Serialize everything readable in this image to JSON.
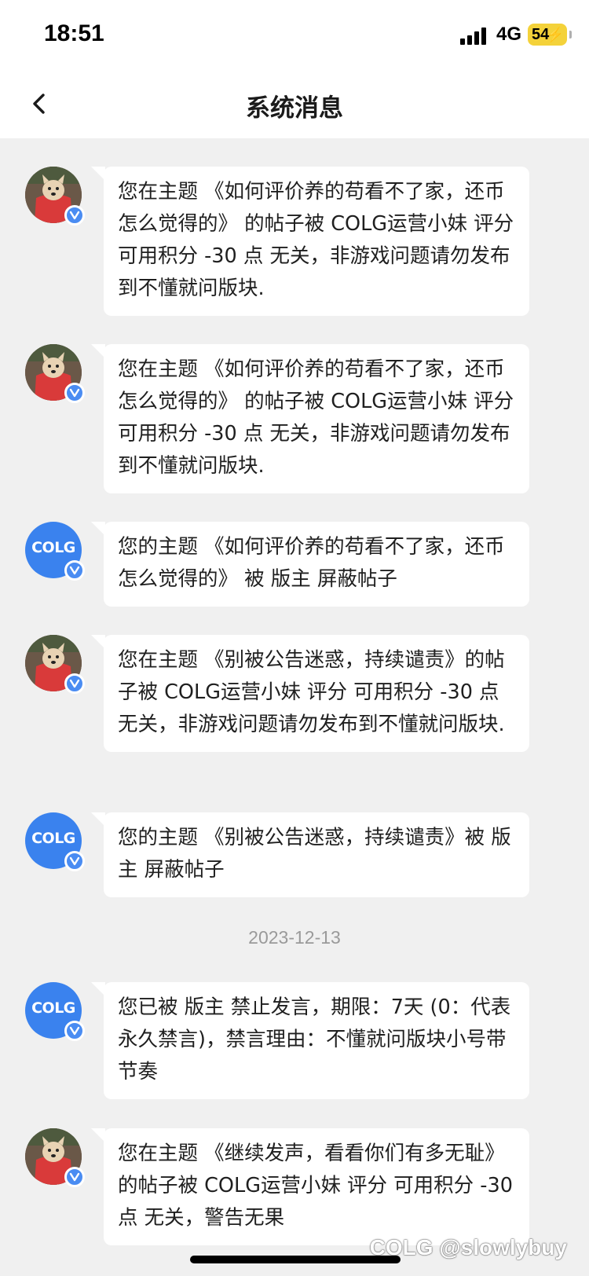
{
  "status_bar": {
    "time": "18:51",
    "network": "4G",
    "battery": "54",
    "battery_color": "#f4d23a"
  },
  "nav": {
    "back_icon": "chevron-left-icon",
    "title": "系统消息"
  },
  "messages": [
    {
      "avatar": "dog",
      "text": "您在主题 《如何评价养的苟看不了家，还币怎么觉得的》 的帖子被 COLG运营小妹 评分 可用积分 -30 点 无关，非游戏问题请勿发布到不懂就问版块."
    },
    {
      "avatar": "dog",
      "text": "您在主题 《如何评价养的苟看不了家，还币怎么觉得的》 的帖子被 COLG运营小妹 评分 可用积分 -30 点 无关，非游戏问题请勿发布到不懂就问版块."
    },
    {
      "avatar": "colg",
      "text": "您的主题 《如何评价养的苟看不了家，还币怎么觉得的》 被 版主 屏蔽帖子"
    },
    {
      "avatar": "dog",
      "text": "您在主题 《别被公告迷惑，持续谴责》的帖子被 COLG运营小妹 评分 可用积分 -30 点 无关，非游戏问题请勿发布到不懂就问版块."
    },
    {
      "avatar": "colg",
      "text": "您的主题 《别被公告迷惑，持续谴责》被 版主 屏蔽帖子"
    },
    {
      "avatar": "colg",
      "text": "您已被 版主 禁止发言，期限：7天 (0：代表永久禁言)，禁言理由：不懂就问版块小号带节奏"
    },
    {
      "avatar": "dog",
      "text": "您在主题 《继续发声，看看你们有多无耻》 的帖子被 COLG运营小妹 评分 可用积分 -30 点 无关，警告无果"
    }
  ],
  "date_separator": "2023-12-13",
  "colg_logo_text": "COLG",
  "watermark": "COLG @slowlybuy",
  "accent_color": "#3a82ee"
}
